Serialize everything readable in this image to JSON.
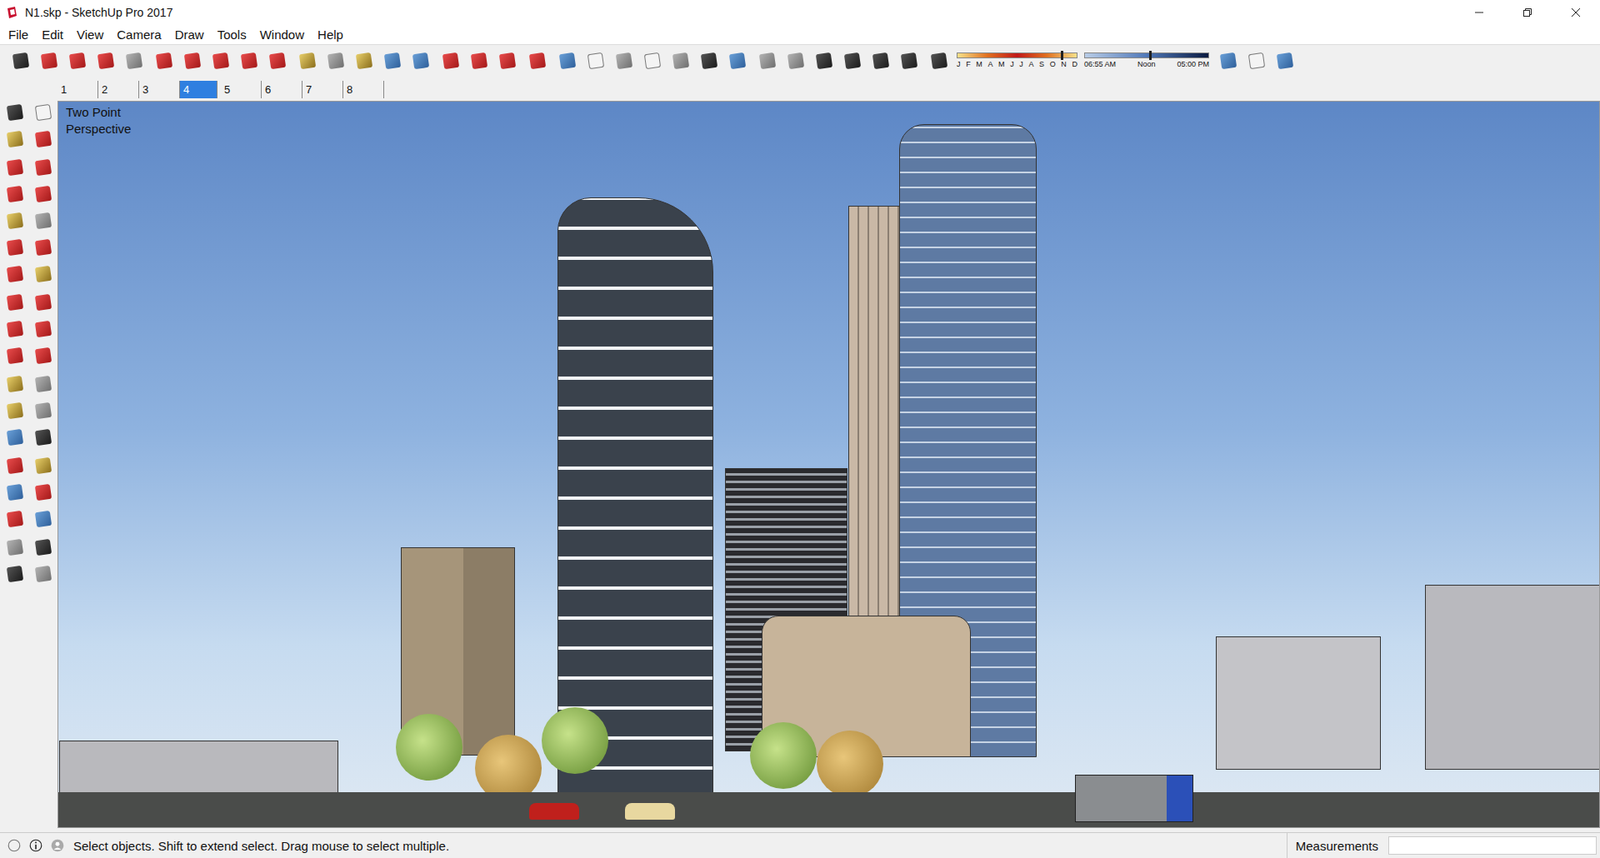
{
  "window": {
    "title": "N1.skp - SketchUp Pro 2017"
  },
  "menu": [
    "File",
    "Edit",
    "View",
    "Camera",
    "Draw",
    "Tools",
    "Window",
    "Help"
  ],
  "shadow_settings": {
    "months": [
      "J",
      "F",
      "M",
      "A",
      "M",
      "J",
      "J",
      "A",
      "S",
      "O",
      "N",
      "D"
    ],
    "date_level": 0.87,
    "time_labels": [
      "06:55 AM",
      "Noon",
      "05:00 PM"
    ],
    "time_level": 0.52
  },
  "scenes": [
    {
      "label": "1",
      "selected": false
    },
    {
      "label": "2",
      "selected": false
    },
    {
      "label": "3",
      "selected": false
    },
    {
      "label": "4",
      "selected": true
    },
    {
      "label": "5",
      "selected": false
    },
    {
      "label": "6",
      "selected": false
    },
    {
      "label": "7",
      "selected": false
    },
    {
      "label": "8",
      "selected": false
    }
  ],
  "viewport": {
    "camera_label": "Two Point Perspective"
  },
  "status_bar": {
    "hint": "Select objects. Shift to extend select. Drag mouse to select multiple.",
    "measurements_label": "Measurements",
    "measurements_value": ""
  }
}
